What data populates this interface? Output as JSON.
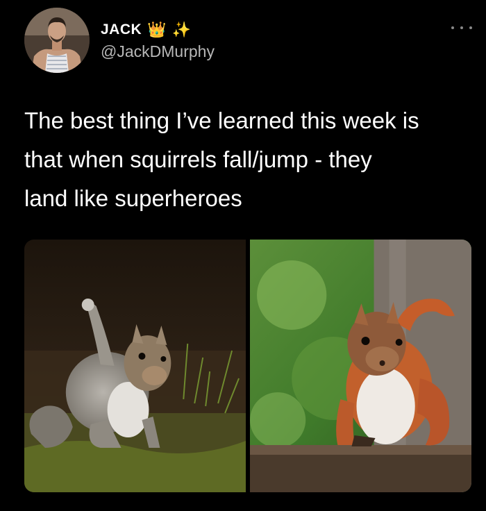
{
  "tweet": {
    "display_name": "JACK",
    "emoji_1": "👑",
    "emoji_2": "✨",
    "handle": "@JackDMurphy",
    "text": "The best thing I’ve learned this week is\nthat when squirrels fall/jump - they\nland like superheroes"
  },
  "media": {
    "photos": [
      {
        "subject": "grey squirrel landing superhero pose"
      },
      {
        "subject": "red squirrel landing superhero pose"
      }
    ]
  },
  "icons": {
    "more": "more-dots-icon"
  },
  "colors": {
    "background": "#000000",
    "text": "#ffffff",
    "secondary_text": "#b8b8b8"
  }
}
